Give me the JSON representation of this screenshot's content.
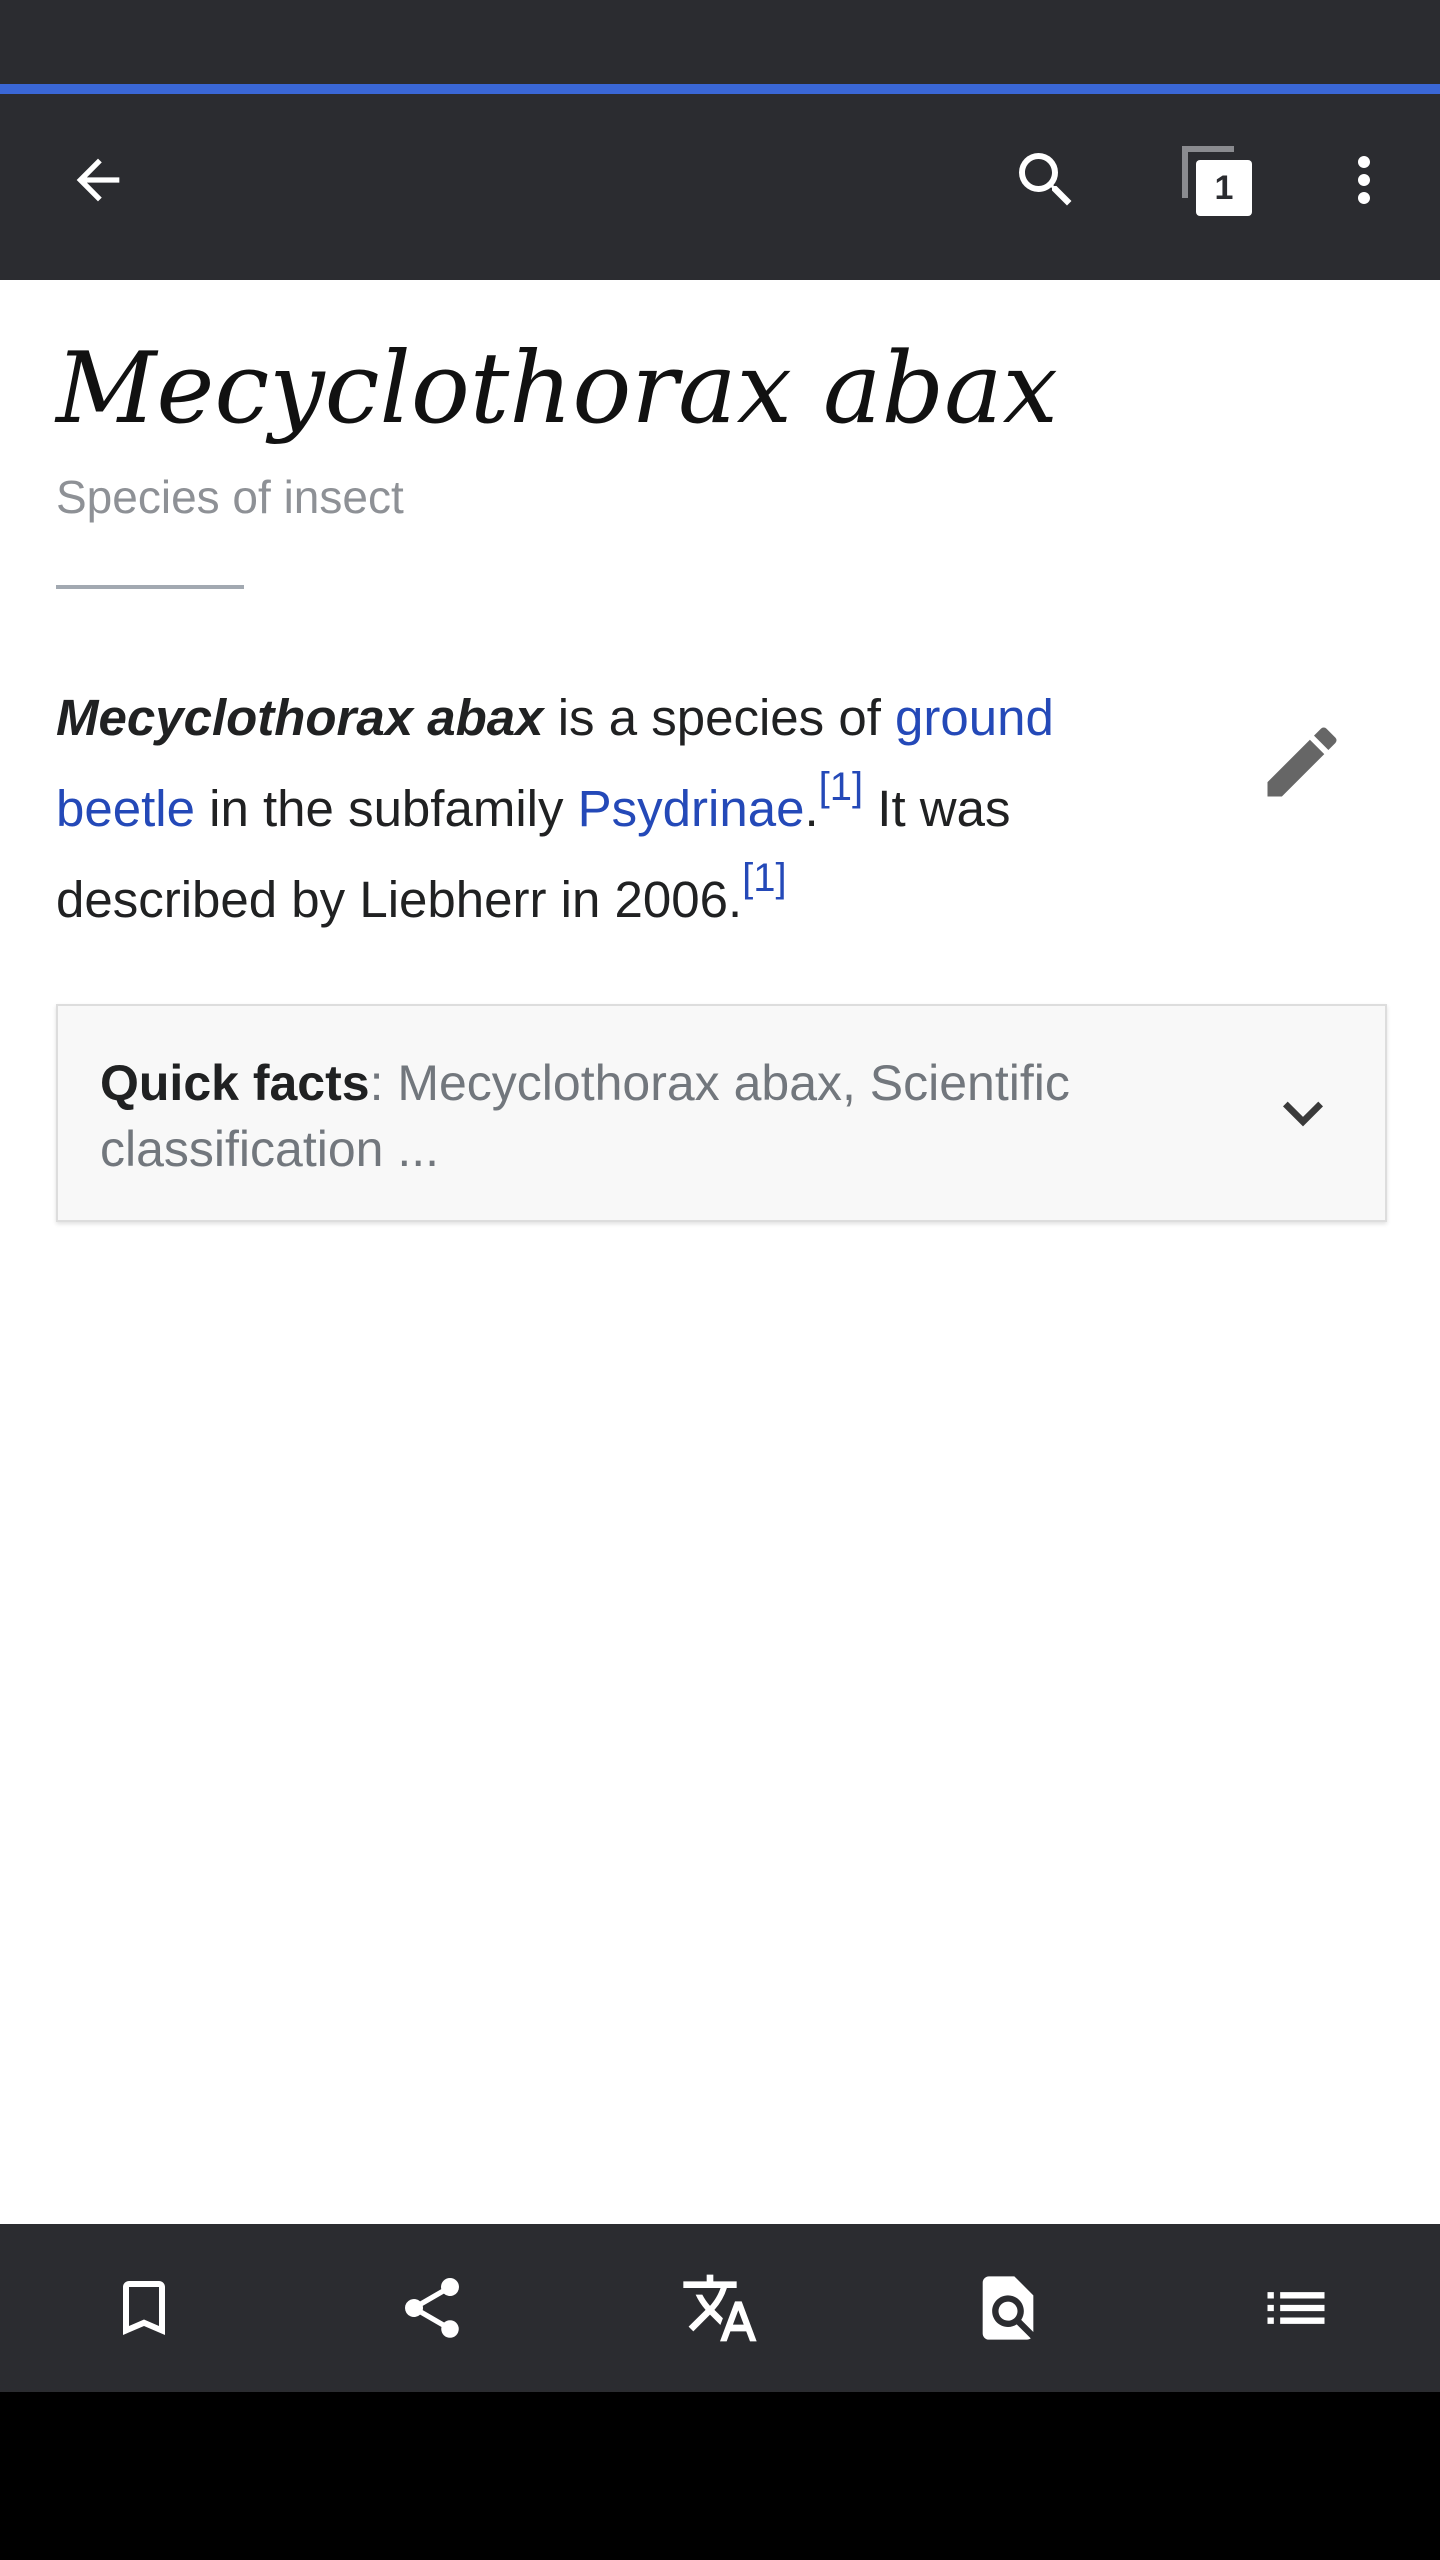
{
  "toolbar": {
    "back_icon": "arrow-left-icon",
    "search_icon": "search-icon",
    "tabs_count": "1",
    "menu_icon": "more-vert-icon"
  },
  "article": {
    "title": "Mecyclothorax abax",
    "subtitle": "Species of insect",
    "lead": {
      "bold_name": "Mecyclothorax abax",
      "text1": " is a species of ",
      "link_ground_beetle": "ground beetle",
      "text2": " in the subfamily ",
      "link_psydrinae": "Psydrinae",
      "text3": ".",
      "ref1": "[1]",
      "text4": " It was described by Liebherr in 2006.",
      "ref2": "[1]"
    },
    "quick_facts": {
      "label": "Quick facts",
      "summary": ": Mecyclothorax abax, Scientific classification ..."
    }
  },
  "bottom_toolbar": {
    "items": [
      "bookmark-icon",
      "share-icon",
      "translate-icon",
      "find-in-page-icon",
      "contents-list-icon"
    ]
  },
  "colors": {
    "app_bar": "#2b2c30",
    "progress": "#3a67d6",
    "link": "#2449b8"
  }
}
